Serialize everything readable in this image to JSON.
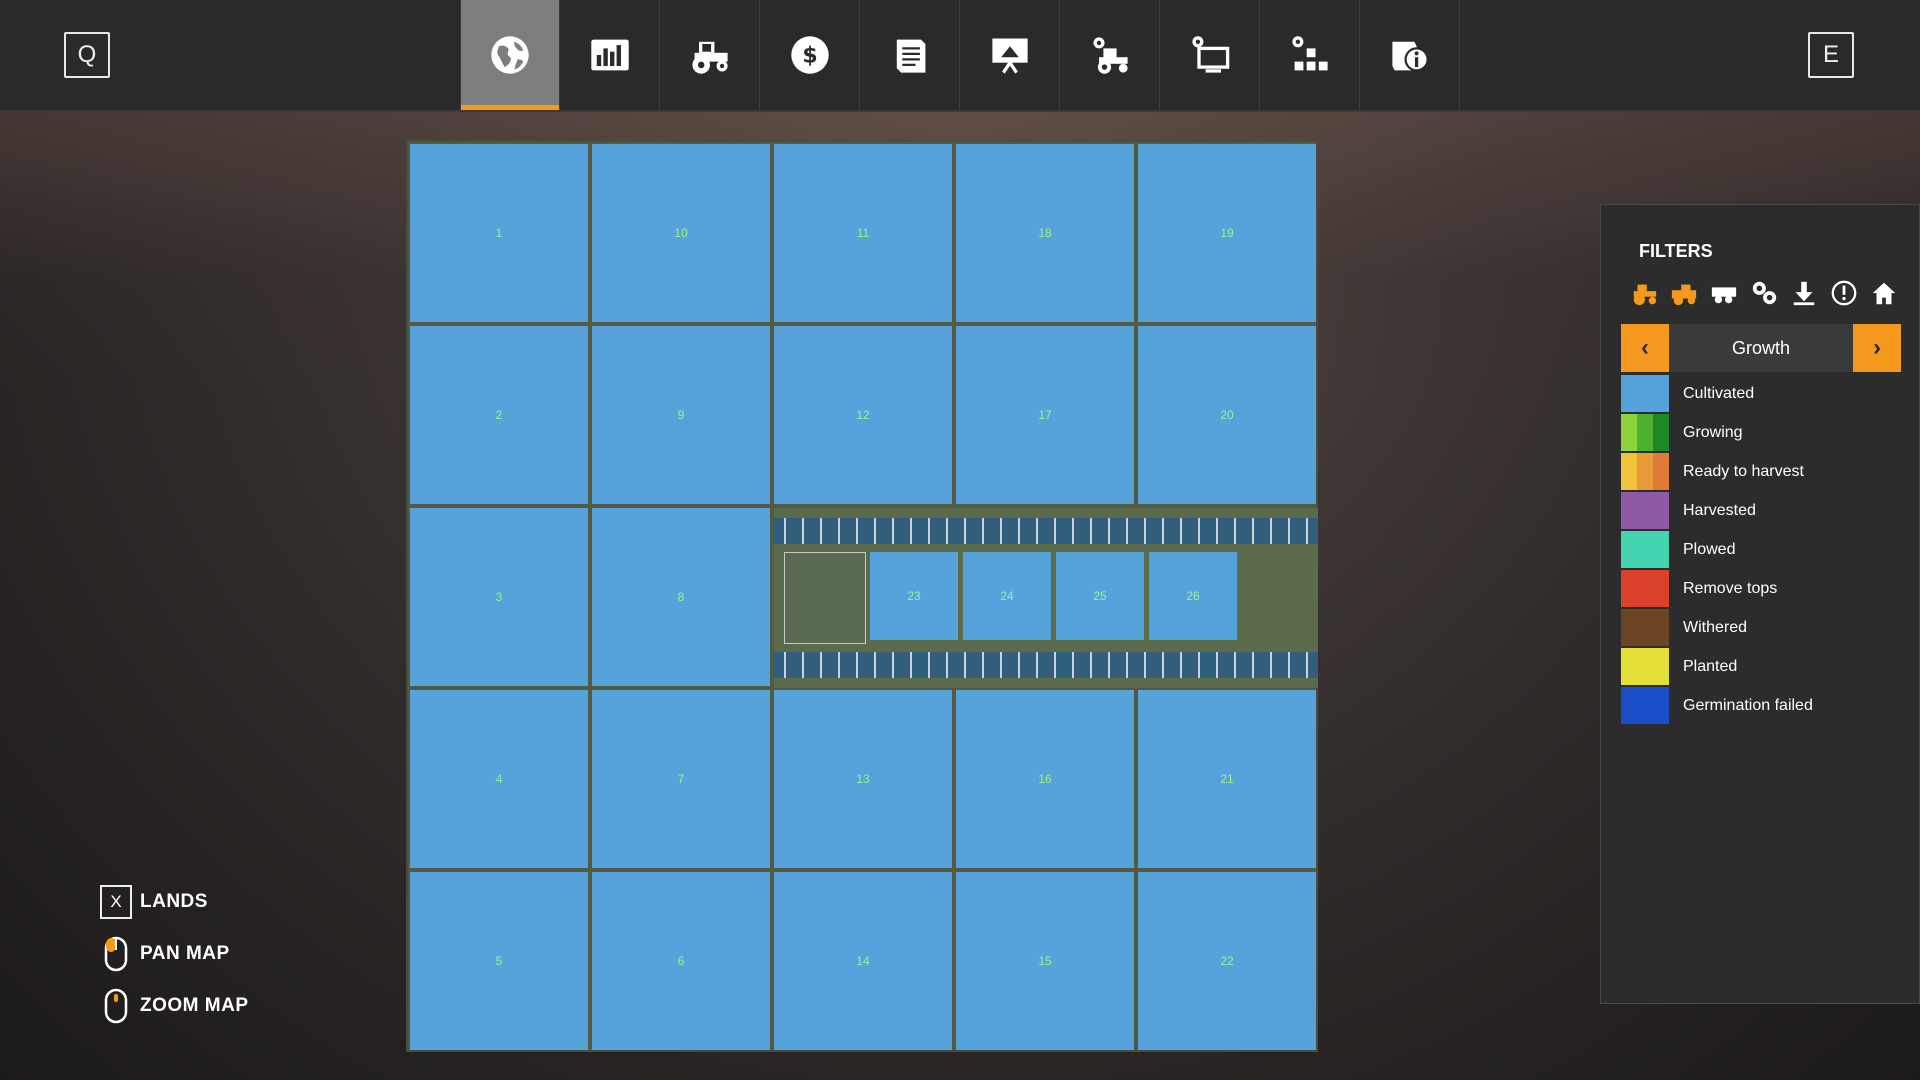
{
  "topbar": {
    "left_key": "Q",
    "right_key": "E",
    "tabs": [
      {
        "icon": "globe-icon",
        "active": true
      },
      {
        "icon": "stats-chart-icon",
        "active": false
      },
      {
        "icon": "tractor-icon",
        "active": false
      },
      {
        "icon": "dollar-icon",
        "active": false
      },
      {
        "icon": "contracts-icon",
        "active": false
      },
      {
        "icon": "presentation-icon",
        "active": false
      },
      {
        "icon": "tractor-settings-icon",
        "active": false
      },
      {
        "icon": "monitor-settings-icon",
        "active": false
      },
      {
        "icon": "production-blocks-icon",
        "active": false
      },
      {
        "icon": "help-info-icon",
        "active": false
      }
    ]
  },
  "map": {
    "fields": [
      "1",
      "10",
      "11",
      "18",
      "19",
      "2",
      "9",
      "12",
      "17",
      "20",
      "3",
      "8",
      "4",
      "7",
      "13",
      "16",
      "21",
      "5",
      "6",
      "14",
      "15",
      "22"
    ],
    "farm_fields": [
      "23",
      "24",
      "25",
      "26"
    ]
  },
  "filters": {
    "title": "FILTERS",
    "icons": [
      "tractor-filter-icon",
      "harvester-filter-icon",
      "trailer-filter-icon",
      "tools-filter-icon",
      "download-filter-icon",
      "warning-filter-icon",
      "home-filter-icon"
    ],
    "selector_label": "Growth",
    "legend": [
      {
        "label": "Cultivated",
        "colors": [
          "#56a3dc"
        ]
      },
      {
        "label": "Growing",
        "colors": [
          "#8fd33a",
          "#4db030",
          "#1f8a25"
        ]
      },
      {
        "label": "Ready to harvest",
        "colors": [
          "#f1c43c",
          "#e99a3a",
          "#e07a3a"
        ]
      },
      {
        "label": "Harvested",
        "colors": [
          "#8e5aa8"
        ]
      },
      {
        "label": "Plowed",
        "colors": [
          "#45d4b0"
        ]
      },
      {
        "label": "Remove tops",
        "colors": [
          "#d9412a"
        ]
      },
      {
        "label": "Withered",
        "colors": [
          "#6b4424"
        ]
      },
      {
        "label": "Planted",
        "colors": [
          "#e4e038"
        ]
      },
      {
        "label": "Germination failed",
        "colors": [
          "#1d4fcb"
        ]
      }
    ]
  },
  "controls": [
    {
      "key": "X",
      "label": "LANDS"
    },
    {
      "mouse": "pan-mouse-icon",
      "label": "PAN MAP"
    },
    {
      "mouse": "zoom-mouse-icon",
      "label": "ZOOM MAP"
    }
  ],
  "colors": {
    "accent": "#f59a1e",
    "field": "#56a3dc",
    "field_label": "#9ff08a"
  }
}
